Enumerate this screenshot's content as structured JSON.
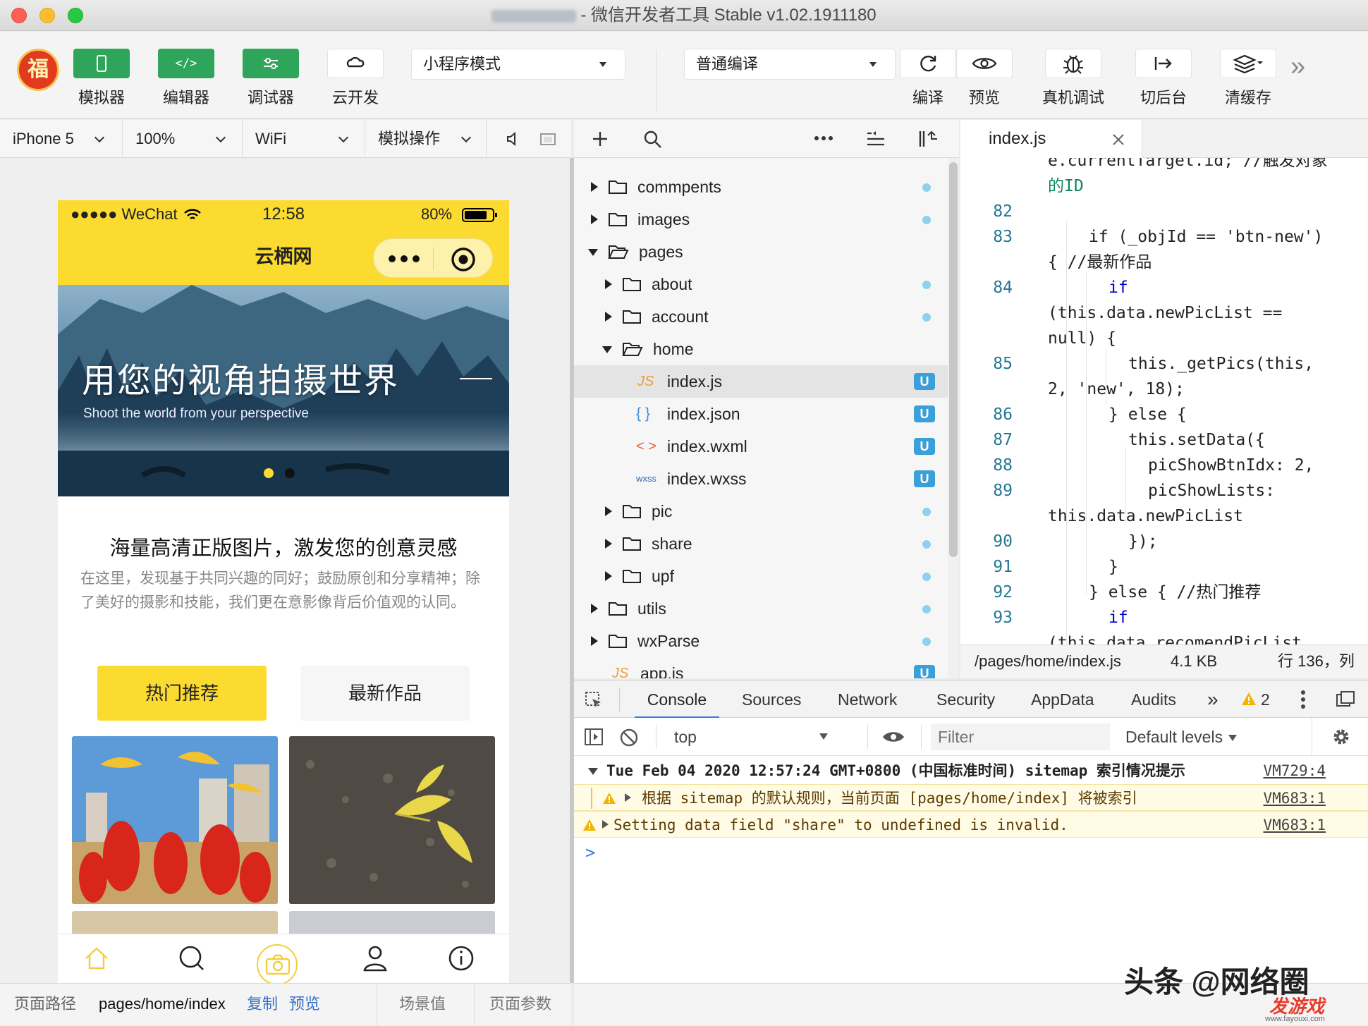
{
  "window": {
    "title": "- 微信开发者工具 Stable v1.02.1911180"
  },
  "toolbar": {
    "simulator": "模拟器",
    "editor": "编辑器",
    "debugger": "调试器",
    "cloud": "云开发",
    "mode": "小程序模式",
    "compile_mode": "普通编译",
    "compile": "编译",
    "preview": "预览",
    "remote_debug": "真机调试",
    "background": "切后台",
    "clear_cache": "清缓存",
    "more": "»"
  },
  "simbar": {
    "device": "iPhone 5",
    "zoom": "100%",
    "network": "WiFi",
    "ops": "模拟操作"
  },
  "phone": {
    "carrier": "●●●●● WeChat",
    "time": "12:58",
    "battery": "80%",
    "nav_title": "云栖网",
    "banner_title": "用您的视角拍摄世界",
    "banner_subtitle": "Shoot the world from your perspective",
    "content_title": "海量高清正版图片，激发您的创意灵感",
    "content_text": "在这里，发现基于共同兴趣的同好；鼓励原创和分享精神；除了美好的摄影和技能，我们更在意影像背后价值观的认同。",
    "tab_hot": "热门推荐",
    "tab_new": "最新作品"
  },
  "pathbar": {
    "label": "页面路径",
    "path": "pages/home/index",
    "copy": "复制",
    "preview": "预览",
    "scene": "场景值",
    "params": "页面参数"
  },
  "tree": [
    {
      "name": "commpents",
      "type": "folder"
    },
    {
      "name": "images",
      "type": "folder"
    },
    {
      "name": "pages",
      "type": "folder-open"
    },
    {
      "name": "about",
      "type": "folder"
    },
    {
      "name": "account",
      "type": "folder"
    },
    {
      "name": "home",
      "type": "folder-open"
    },
    {
      "name": "index.js",
      "type": "js",
      "badge": "U"
    },
    {
      "name": "index.json",
      "type": "json",
      "badge": "U"
    },
    {
      "name": "index.wxml",
      "type": "wxml",
      "badge": "U"
    },
    {
      "name": "index.wxss",
      "type": "wxss",
      "badge": "U"
    },
    {
      "name": "pic",
      "type": "folder"
    },
    {
      "name": "share",
      "type": "folder"
    },
    {
      "name": "upf",
      "type": "folder"
    },
    {
      "name": "utils",
      "type": "folder"
    },
    {
      "name": "wxParse",
      "type": "folder"
    },
    {
      "name": "app.js",
      "type": "js",
      "badge": "U"
    }
  ],
  "file_icons": {
    "js": "JS",
    "json": "{ }",
    "wxml": "< >",
    "wxss": "wxss"
  },
  "editor": {
    "tab": "index.js",
    "status_path": "/pages/home/index.js",
    "status_size": "4.1 KB",
    "status_pos": "行 136，列"
  },
  "code": [
    {
      "n": "",
      "t": "e.currentTarget.id; //触发对象"
    },
    {
      "n": "",
      "t": "的ID"
    },
    {
      "n": "82",
      "t": ""
    },
    {
      "n": "83",
      "t": "if (_objId == 'btn-new')"
    },
    {
      "n": "",
      "t": "{ //最新作品"
    },
    {
      "n": "84",
      "t": "if"
    },
    {
      "n": "",
      "t": "(this.data.newPicList =="
    },
    {
      "n": "",
      "t": "null) {"
    },
    {
      "n": "85",
      "t": "this._getPics(this,"
    },
    {
      "n": "",
      "t": "2, 'new', 18);"
    },
    {
      "n": "86",
      "t": "} else {"
    },
    {
      "n": "87",
      "t": "this.setData({"
    },
    {
      "n": "88",
      "t": "picShowBtnIdx: 2,"
    },
    {
      "n": "89",
      "t": "picShowLists:"
    },
    {
      "n": "",
      "t": "this.data.newPicList"
    },
    {
      "n": "90",
      "t": "});"
    },
    {
      "n": "91",
      "t": "}"
    },
    {
      "n": "92",
      "t": "} else { //热门推荐"
    },
    {
      "n": "93",
      "t": "if"
    },
    {
      "n": "",
      "t": "(this.data.recomendPicList"
    }
  ],
  "devtools": {
    "tabs": [
      "Console",
      "Sources",
      "Network",
      "Security",
      "AppData",
      "Audits"
    ],
    "more": "»",
    "warn_count": "2",
    "context": "top",
    "filter_placeholder": "Filter",
    "levels": "Default levels",
    "console": [
      {
        "text": "Tue Feb 04 2020 12:57:24 GMT+0800 (中国标准时间) sitemap 索引情况提示",
        "src": "VM729:4"
      },
      {
        "text": "根据 sitemap 的默认规则，当前页面 [pages/home/index] 将被索引",
        "src": "VM683:1"
      },
      {
        "text": "Setting data field \"share\" to undefined is invalid.",
        "src": "VM683:1"
      }
    ],
    "prompt": ">"
  },
  "watermark": {
    "text": "头条 @网络圈",
    "logo": "发游戏",
    "url": "www.fayouxi.com"
  },
  "colors": {
    "green": "#2ea55b",
    "yellow": "#fcdb30",
    "badge": "#3ca0d8"
  }
}
